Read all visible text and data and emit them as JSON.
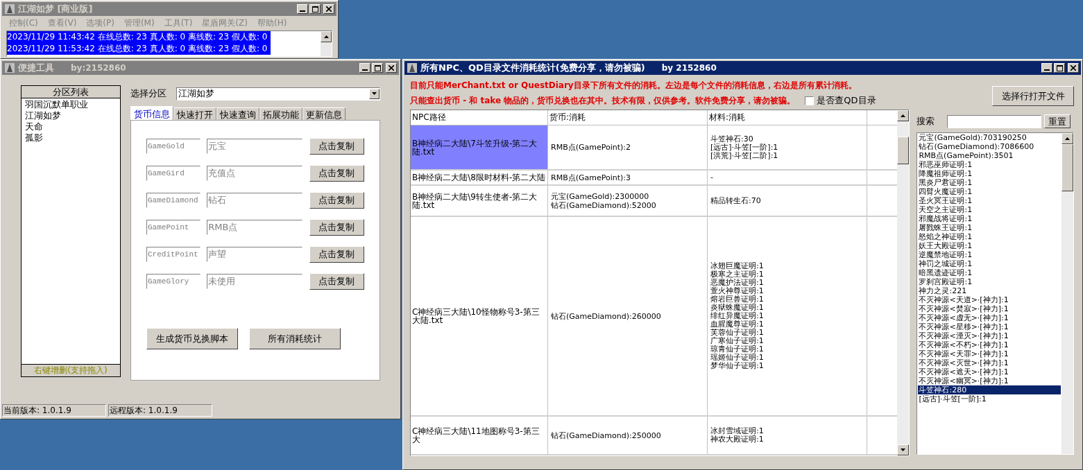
{
  "main_window": {
    "title": "江湖如梦 [商业版]",
    "menu": [
      "控制(C)",
      "查看(V)",
      "选项(P)",
      "管理(M)",
      "工具(T)",
      "星盾网关(Z)",
      "帮助(H)"
    ],
    "log_lines": [
      "2023/11/29 11:43:42 在线总数: 23 真人数: 0 离线数: 23 假人数: 0",
      "2023/11/29 11:53:42 在线总数: 23 真人数: 0 离线数: 23 假人数: 0"
    ]
  },
  "tool_window": {
    "title": "便捷工具",
    "author": "by:2152860",
    "partition_list": {
      "header": "分区列表",
      "items": [
        "羽国沉默单职业",
        "江湖如梦",
        "天命",
        "孤影"
      ],
      "footer": "右键增删(支持拖入)"
    },
    "select_label": "选择分区",
    "select_value": "江湖如梦",
    "tabs": [
      {
        "label": "货币信息",
        "selected": true
      },
      {
        "label": "快速打开",
        "selected": false
      },
      {
        "label": "快速查询",
        "selected": false
      },
      {
        "label": "拓展功能",
        "selected": false
      },
      {
        "label": "更新信息",
        "selected": false
      }
    ],
    "currency_rows": [
      {
        "code": "GameGold",
        "name": "元宝",
        "button": "点击复制"
      },
      {
        "code": "GameGird",
        "name": "充值点",
        "button": "点击复制"
      },
      {
        "code": "GameDiamond",
        "name": "钻石",
        "button": "点击复制"
      },
      {
        "code": "GamePoint",
        "name": "RMB点",
        "button": "点击复制"
      },
      {
        "code": "CreditPoint",
        "name": "声望",
        "button": "点击复制"
      },
      {
        "code": "GameGlory",
        "name": "未使用",
        "button": "点击复制"
      }
    ],
    "buttons": [
      "生成货币兑换脚本",
      "所有消耗统计"
    ],
    "status_bar": [
      "当前版本: 1.0.1.9",
      "远程版本: 1.0.1.9"
    ]
  },
  "stats_window": {
    "title": "所有NPC、QD目录文件消耗统计(免费分享，请勿被骗)",
    "author": "by 2152860",
    "notices": [
      "目前只能MerChant.txt or QuestDiary目录下所有文件的消耗。左边是每个文件的消耗信息，右边是所有累计消耗。",
      "只能查出货币 - 和 take 物品的，货币兑换也在其中。技术有限，仅供参考。软件免费分享，请勿被骗。"
    ],
    "qd_checkbox": {
      "label": "是否查QD目录",
      "checked": false
    },
    "open_button": "选择行打开文件",
    "table": {
      "columns": [
        "NPC路径",
        "货币:消耗",
        "材料:消耗"
      ],
      "rows": [
        {
          "path": "B神经病二大陆\\7斗笠升级-第二大陆.txt",
          "currency": [
            "RMB点(GamePoint):2"
          ],
          "materials": [
            "斗笠神石:30",
            "[远古]·斗笠[一阶]:1",
            "[洪荒]·斗笠[二阶]:1"
          ],
          "selected": true
        },
        {
          "path": "B神经病二大陆\\8限时材料-第二大陆",
          "currency": [
            "RMB点(GamePoint):3"
          ],
          "materials": [
            "-"
          ],
          "selected": false
        },
        {
          "path": "B神经病二大陆\\9转生使者-第二大陆.txt",
          "currency": [
            "元宝(GameGold):2300000",
            "钻石(GameDiamond):52000"
          ],
          "materials": [
            "精品转生石:70"
          ],
          "selected": false
        },
        {
          "path": "C神经病三大陆\\10怪物称号3-第三大陆.txt",
          "currency": [
            "钻石(GameDiamond):260000"
          ],
          "materials": [
            "冰翅巨魔证明:1",
            "极寒之主证明:1",
            "恶魔护法证明:1",
            "萱火神尊证明:1",
            "熔岩巨兽证明:1",
            "炎狱蛛魔证明:1",
            "绯红异魔证明:1",
            "血腥魔尊证明:1",
            "芙蓉仙子证明:1",
            "广寒仙子证明:1",
            "琼青仙子证明:1",
            "瑶姬仙子证明:1",
            "梦华仙子证明:1"
          ],
          "selected": false
        },
        {
          "path": "C神经病三大陆\\11地图称号3-第三大",
          "currency": [
            "钻石(GameDiamond):250000"
          ],
          "materials": [
            "冰封雪域证明:1",
            "神农大殿证明:1"
          ],
          "selected": false
        }
      ]
    },
    "search": {
      "label": "搜索",
      "button": "重置"
    },
    "totals": [
      {
        "text": "元宝(GameGold):703190250",
        "selected": false
      },
      {
        "text": "钻石(GameDiamond):7086600",
        "selected": false
      },
      {
        "text": "RMB点(GamePoint):3501",
        "selected": false
      },
      {
        "text": "邪恶巫师证明:1",
        "selected": false
      },
      {
        "text": "降魔祖师证明:1",
        "selected": false
      },
      {
        "text": "黑炎尸君证明:1",
        "selected": false
      },
      {
        "text": "四臂火魔证明:1",
        "selected": false
      },
      {
        "text": "圣火冥王证明:1",
        "selected": false
      },
      {
        "text": "天空之主证明:1",
        "selected": false
      },
      {
        "text": "邪魔战将证明:1",
        "selected": false
      },
      {
        "text": "屠戮蛛王证明:1",
        "selected": false
      },
      {
        "text": "怒焰之神证明:1",
        "selected": false
      },
      {
        "text": "妖王大殿证明:1",
        "selected": false
      },
      {
        "text": "逆魔禁地证明:1",
        "selected": false
      },
      {
        "text": "神罚之城证明:1",
        "selected": false
      },
      {
        "text": "暗黑遗迹证明:1",
        "selected": false
      },
      {
        "text": "罗刹宫殿证明:1",
        "selected": false
      },
      {
        "text": "神力之灵:221",
        "selected": false
      },
      {
        "text": "不灭神源<天道>·[神力]:1",
        "selected": false
      },
      {
        "text": "不灭神源<焚寂>·[神力]:1",
        "selected": false
      },
      {
        "text": "不灭神源<虚无>·[神力]:1",
        "selected": false
      },
      {
        "text": "不灭神源<星移>·[神力]:1",
        "selected": false
      },
      {
        "text": "不灭神源<湮灭>·[神力]:1",
        "selected": false
      },
      {
        "text": "不灭神源<不朽>·[神力]:1",
        "selected": false
      },
      {
        "text": "不灭神源<天罪>·[神力]:1",
        "selected": false
      },
      {
        "text": "不灭神源<灭世>·[神力]:1",
        "selected": false
      },
      {
        "text": "不灭神源<遮天>·[神力]:1",
        "selected": false
      },
      {
        "text": "不灭神源<幽冥>·[神力]:1",
        "selected": false
      },
      {
        "text": "斗笠神石:280",
        "selected": true
      },
      {
        "text": "[远古]·斗笠[一阶]:1",
        "selected": false
      }
    ]
  }
}
